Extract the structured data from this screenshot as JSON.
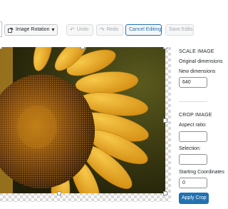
{
  "toolbar": {
    "image_rotation_label": "Image Rotation",
    "undo_label": "Undo",
    "redo_label": "Redo",
    "cancel_editing_label": "Cancel Editing",
    "save_edits_label": "Save Edits"
  },
  "sidebar": {
    "scale_heading": "SCALE IMAGE",
    "original_dimensions_label": "Original dimensions",
    "new_dimensions_label": "New dimensions",
    "new_width_value": "640",
    "crop_heading": "CROP IMAGE",
    "aspect_ratio_label": "Aspect ratio:",
    "aspect_ratio_value": "",
    "selection_label": "Selection:",
    "selection_value": "",
    "starting_coordinates_label": "Starting Coordinates",
    "starting_x_value": "0",
    "apply_crop_label": "Apply Crop"
  },
  "colors": {
    "accent": "#2271b1",
    "border": "#c3c4c7",
    "disabled_text": "#a7aaad"
  }
}
